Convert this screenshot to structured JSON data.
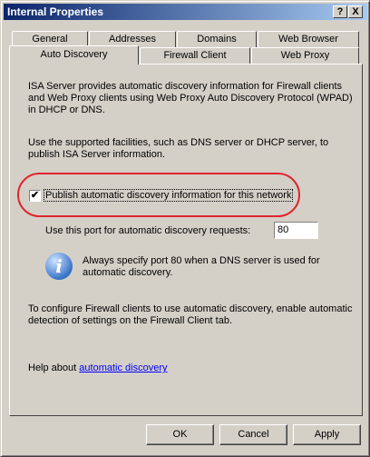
{
  "window": {
    "title": "Internal Properties",
    "help_btn": "?",
    "close_btn": "X"
  },
  "tabs_back": [
    "General",
    "Addresses",
    "Domains",
    "Web Browser"
  ],
  "tabs_front": [
    "Auto Discovery",
    "Firewall Client",
    "Web Proxy"
  ],
  "active_tab": "Auto Discovery",
  "content": {
    "intro": "ISA Server provides automatic discovery information for Firewall clients and Web Proxy clients using Web Proxy Auto Discovery Protocol (WPAD) in DHCP or DNS.",
    "facilities": "Use the supported facilities, such as DNS server or DHCP server, to publish ISA Server information.",
    "publish_checkbox": {
      "label": "Publish automatic discovery information for this network",
      "checked": true
    },
    "port_label": "Use this port for automatic discovery requests:",
    "port_value": "80",
    "info_note": "Always specify port 80 when a DNS server is used for automatic discovery.",
    "firewall_note": "To configure Firewall clients to use automatic discovery, enable automatic detection of settings on the Firewall Client tab.",
    "help_prefix": "Help about",
    "help_link": "automatic discovery"
  },
  "buttons": {
    "ok": "OK",
    "cancel": "Cancel",
    "apply": "Apply"
  },
  "colors": {
    "highlight": "#e0242b",
    "title_bar": "#0a246a",
    "link": "#0000ff"
  }
}
